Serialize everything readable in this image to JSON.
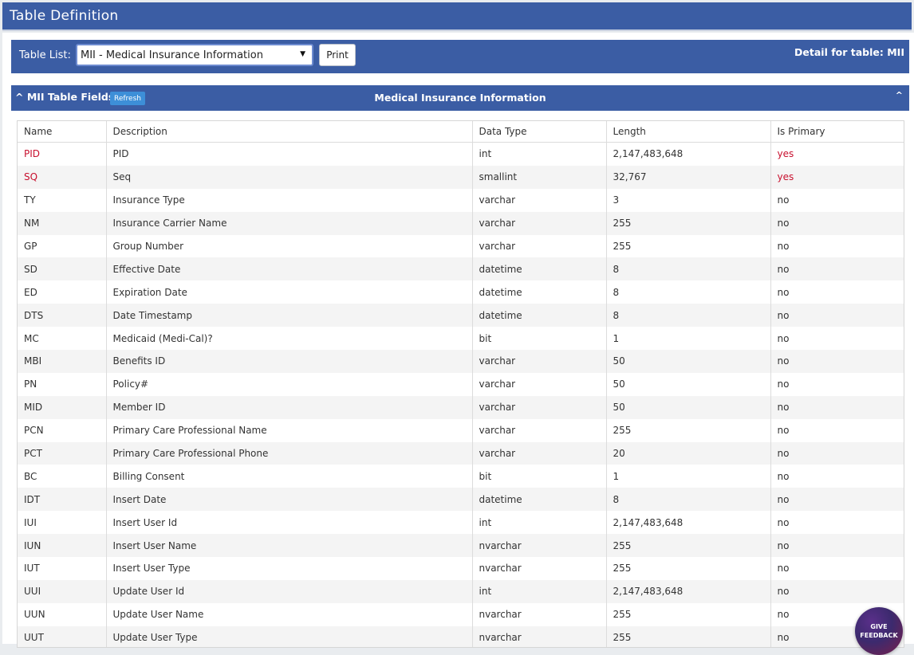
{
  "title": "Table Definition",
  "select_bar": {
    "label": "Table List:",
    "selected": "MII - Medical Insurance Information",
    "print_label": "Print",
    "detail_text": "Detail for table: MII"
  },
  "section": {
    "toggle_label": "^ MII Table Fields:",
    "refresh_label": "Refresh",
    "heading": "Medical Insurance Information",
    "collapse_glyph": "^"
  },
  "table": {
    "headers": [
      "Name",
      "Description",
      "Data Type",
      "Length",
      "Is Primary"
    ],
    "rows": [
      [
        "PID",
        "PID",
        "int",
        "2,147,483,648",
        "yes"
      ],
      [
        "SQ",
        "Seq",
        "smallint",
        "32,767",
        "yes"
      ],
      [
        "TY",
        "Insurance Type",
        "varchar",
        "3",
        "no"
      ],
      [
        "NM",
        "Insurance Carrier Name",
        "varchar",
        "255",
        "no"
      ],
      [
        "GP",
        "Group Number",
        "varchar",
        "255",
        "no"
      ],
      [
        "SD",
        "Effective Date",
        "datetime",
        "8",
        "no"
      ],
      [
        "ED",
        "Expiration Date",
        "datetime",
        "8",
        "no"
      ],
      [
        "DTS",
        "Date Timestamp",
        "datetime",
        "8",
        "no"
      ],
      [
        "MC",
        "Medicaid (Medi-Cal)?",
        "bit",
        "1",
        "no"
      ],
      [
        "MBI",
        "Benefits ID",
        "varchar",
        "50",
        "no"
      ],
      [
        "PN",
        "Policy#",
        "varchar",
        "50",
        "no"
      ],
      [
        "MID",
        "Member ID",
        "varchar",
        "50",
        "no"
      ],
      [
        "PCN",
        "Primary Care Professional Name",
        "varchar",
        "255",
        "no"
      ],
      [
        "PCT",
        "Primary Care Professional Phone",
        "varchar",
        "20",
        "no"
      ],
      [
        "BC",
        "Billing Consent",
        "bit",
        "1",
        "no"
      ],
      [
        "IDT",
        "Insert Date",
        "datetime",
        "8",
        "no"
      ],
      [
        "IUI",
        "Insert User Id",
        "int",
        "2,147,483,648",
        "no"
      ],
      [
        "IUN",
        "Insert User Name",
        "nvarchar",
        "255",
        "no"
      ],
      [
        "IUT",
        "Insert User Type",
        "nvarchar",
        "255",
        "no"
      ],
      [
        "UUI",
        "Update User Id",
        "int",
        "2,147,483,648",
        "no"
      ],
      [
        "UUN",
        "Update User Name",
        "nvarchar",
        "255",
        "no"
      ],
      [
        "UUT",
        "Update User Type",
        "nvarchar",
        "255",
        "no"
      ]
    ]
  },
  "feedback": {
    "line1": "GIVE",
    "line2": "FEEDBACK"
  },
  "colors": {
    "header_blue": "#3b5da4",
    "primary_key_red": "#c8102e",
    "refresh_blue": "#3d8fd8"
  }
}
